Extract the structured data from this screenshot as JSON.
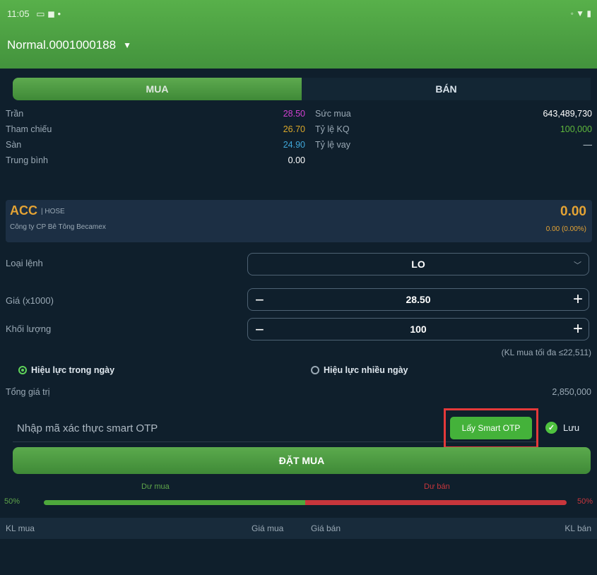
{
  "status": {
    "time": "11:05",
    "icons_left": "▭ ◼ •",
    "icons_right": "◦ ▼ ▮"
  },
  "account": {
    "label": "Normal.0001000188"
  },
  "tabs": {
    "buy": "MUA",
    "sell": "BÁN"
  },
  "info": {
    "rows": [
      {
        "label": "Trần",
        "value": "28.50",
        "value_color": "#d040d0",
        "label2": "Sức mua",
        "value2": "643,489,730",
        "value2_color": "#ffffff"
      },
      {
        "label": "Tham chiếu",
        "value": "26.70",
        "value_color": "#d9a72a",
        "label2": "Tỷ lệ KQ",
        "value2": "100,000",
        "value2_color": "#5fb83c"
      },
      {
        "label": "Sàn",
        "value": "24.90",
        "value_color": "#3fa6d8",
        "label2": "Tỷ lệ vay",
        "value2": "—",
        "value2_color": "#c9d4dc"
      },
      {
        "label": "Trung bình",
        "value": "0.00",
        "value_color": "#ffffff",
        "label2": "",
        "value2": "",
        "value2_color": "#c9d4dc"
      }
    ]
  },
  "stock": {
    "symbol": "ACC",
    "exchange": "| HOSE",
    "company": "Công ty CP Bê Tông Becamex",
    "price": "0.00",
    "change": "0.00 (0.00%)"
  },
  "form": {
    "order_type_label": "Loại lệnh",
    "order_type_value": "LO",
    "price_label": "Giá (x1000)",
    "price_value": "28.50",
    "qty_label": "Khối lượng",
    "qty_value": "100",
    "max_note": "(KL mua tối đa ≤22,511)",
    "validity_day": "Hiệu lực trong ngày",
    "validity_multi": "Hiệu lực nhiều ngày",
    "total_label": "Tổng giá trị",
    "total_value": "2,850,000",
    "otp_placeholder": "Nhập mã xác thực smart OTP",
    "otp_button": "Lấy Smart OTP",
    "save_label": "Lưu",
    "submit": "ĐẶT MUA"
  },
  "depth": {
    "buy_label": "Dư mua",
    "sell_label": "Dư bán",
    "buy_pct": "50%",
    "sell_pct": "50%",
    "buy_ratio": 0.5
  },
  "table": {
    "headers": [
      "KL mua",
      "Giá mua",
      "Giá bán",
      "KL bán"
    ]
  },
  "colors": {
    "accent": "#4fa64a",
    "sell": "#c8363c"
  }
}
